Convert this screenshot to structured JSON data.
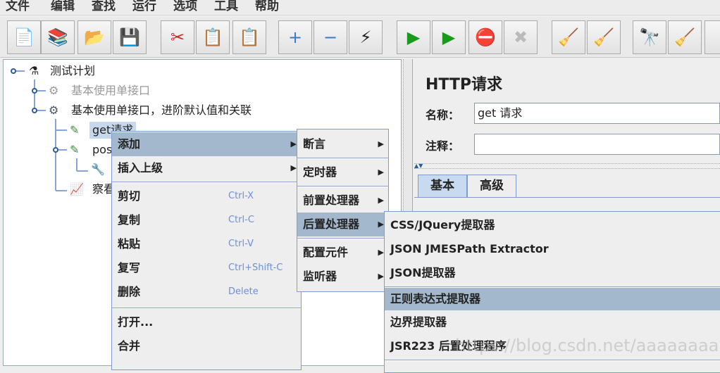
{
  "menubar": [
    "文件",
    "编辑",
    "查找",
    "运行",
    "选项",
    "工具",
    "帮助"
  ],
  "toolbar": [
    {
      "name": "new-icon",
      "glyph": "📄"
    },
    {
      "name": "templates-icon",
      "glyph": "📚"
    },
    {
      "name": "open-icon",
      "glyph": "📂"
    },
    {
      "name": "save-icon",
      "glyph": "💾"
    },
    {
      "name": "cut-icon",
      "glyph": "✂"
    },
    {
      "name": "copy-icon",
      "glyph": "📋"
    },
    {
      "name": "paste-icon",
      "glyph": "📋"
    },
    {
      "name": "expand-icon",
      "glyph": "+"
    },
    {
      "name": "collapse-icon",
      "glyph": "−"
    },
    {
      "name": "toggle-icon",
      "glyph": "⚡"
    },
    {
      "name": "start-icon",
      "glyph": "▶"
    },
    {
      "name": "start-no-pause-icon",
      "glyph": "▶"
    },
    {
      "name": "stop-icon",
      "glyph": "⛔"
    },
    {
      "name": "shutdown-icon",
      "glyph": "✖"
    },
    {
      "name": "clear-icon",
      "glyph": "🧹"
    },
    {
      "name": "clear-all-icon",
      "glyph": "🧹"
    },
    {
      "name": "search-icon",
      "glyph": "🔭"
    },
    {
      "name": "reset-search-icon",
      "glyph": "🧹"
    }
  ],
  "tree": {
    "root": "测试计划",
    "group1": "基本使用单接口",
    "group2": "基本使用单接口，进阶默认值和关联",
    "get": "get请求",
    "post": "post",
    "listener": "察看"
  },
  "context_menu": {
    "items": [
      {
        "label": "添加",
        "submenu": true
      },
      {
        "label": "插入上级",
        "submenu": true
      }
    ],
    "edit": [
      {
        "label": "剪切",
        "shortcut": "Ctrl-X"
      },
      {
        "label": "复制",
        "shortcut": "Ctrl-C"
      },
      {
        "label": "粘贴",
        "shortcut": "Ctrl-V"
      },
      {
        "label": "复写",
        "shortcut": "Ctrl+Shift-C"
      },
      {
        "label": "删除",
        "shortcut": "Delete"
      }
    ],
    "file": [
      "打开...",
      "合并"
    ]
  },
  "add_menu": [
    "断言",
    "定时器",
    "前置处理器",
    "后置处理器",
    "配置元件",
    "监听器"
  ],
  "post_menu": [
    "CSS/JQuery提取器",
    "JSON JMESPath Extractor",
    "JSON提取器",
    "正则表达式提取器",
    "边界提取器",
    "JSR223 后置处理程序"
  ],
  "panel": {
    "title": "HTTP请求",
    "name_label": "名称：",
    "name_value": "get 请求",
    "comment_label": "注释：",
    "comment_value": "",
    "tabs": [
      "基本",
      "高级"
    ]
  },
  "watermark": "https://blog.csdn.net/aaaaaaaaanjjj"
}
